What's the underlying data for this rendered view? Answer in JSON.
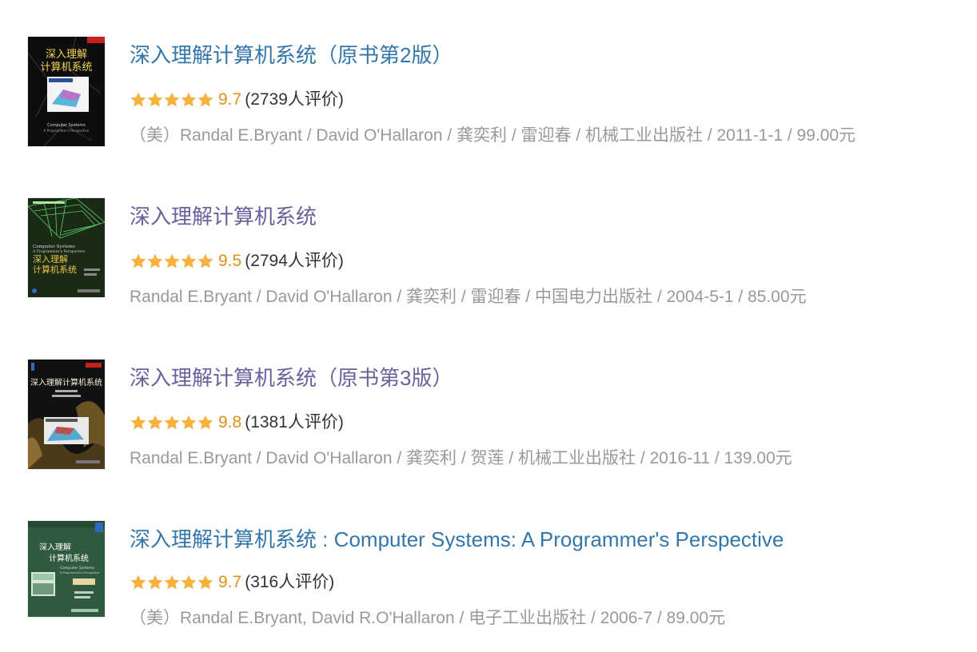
{
  "colors": {
    "visited_title": "#6b5f9c",
    "link_title": "#3377aa",
    "score": "#e09015",
    "star": "#f6b23e",
    "meta": "#999999",
    "count": "#333333"
  },
  "books": [
    {
      "title": "深入理解计算机系统（原书第2版）",
      "rating": 5,
      "score": "9.7",
      "count_text": "(2739人评价)",
      "pub": "（美）Randal E.Bryant / David O'Hallaron / 龚奕利 / 雷迎春 / 机械工业出版社 / 2011-1-1 / 99.00元",
      "cover": {
        "bg": "#0d0d0d",
        "accent": "#c81f1f",
        "label_color": "#f2d74a",
        "cover_title": "深入理解\n计算机系统",
        "cover_sub": "Computer Systems"
      }
    },
    {
      "title": "深入理解计算机系统",
      "rating": 5,
      "score": "9.5",
      "count_text": "(2794人评价)",
      "pub": "Randal E.Bryant / David O'Hallaron / 龚奕利 / 雷迎春 / 中国电力出版社 / 2004-5-1 / 85.00元",
      "cover": {
        "bg": "#1a2a14",
        "accent": "#5ad06a",
        "label_color": "#e7c24a",
        "cover_title": "深入理解\n计算机系统",
        "cover_sub": "Computer Systems"
      }
    },
    {
      "title": "深入理解计算机系统（原书第3版）",
      "rating": 5,
      "score": "9.8",
      "count_text": "(1381人评价)",
      "pub": "Randal E.Bryant / David O'Hallaron / 龚奕利 / 贺莲 / 机械工业出版社 / 2016-11 / 139.00元",
      "cover": {
        "bg": "#111111",
        "accent": "#b58b3a",
        "label_color": "#f5f0d8",
        "cover_title": "深入理解计算机系统",
        "cover_sub": "Computer Systems"
      }
    },
    {
      "title": "深入理解计算机系统 : Computer Systems: A Programmer's Perspective",
      "rating": 5,
      "score": "9.7",
      "count_text": "(316人评价)",
      "pub": "（美）Randal E.Bryant, David R.O'Hallaron / 电子工业出版社 / 2006-7 / 89.00元",
      "cover": {
        "bg": "#2f5a3f",
        "accent": "#9cc7a8",
        "label_color": "#ffffff",
        "cover_title": "深入理解\n计算机系统",
        "cover_sub": "Computer Systems"
      }
    }
  ]
}
